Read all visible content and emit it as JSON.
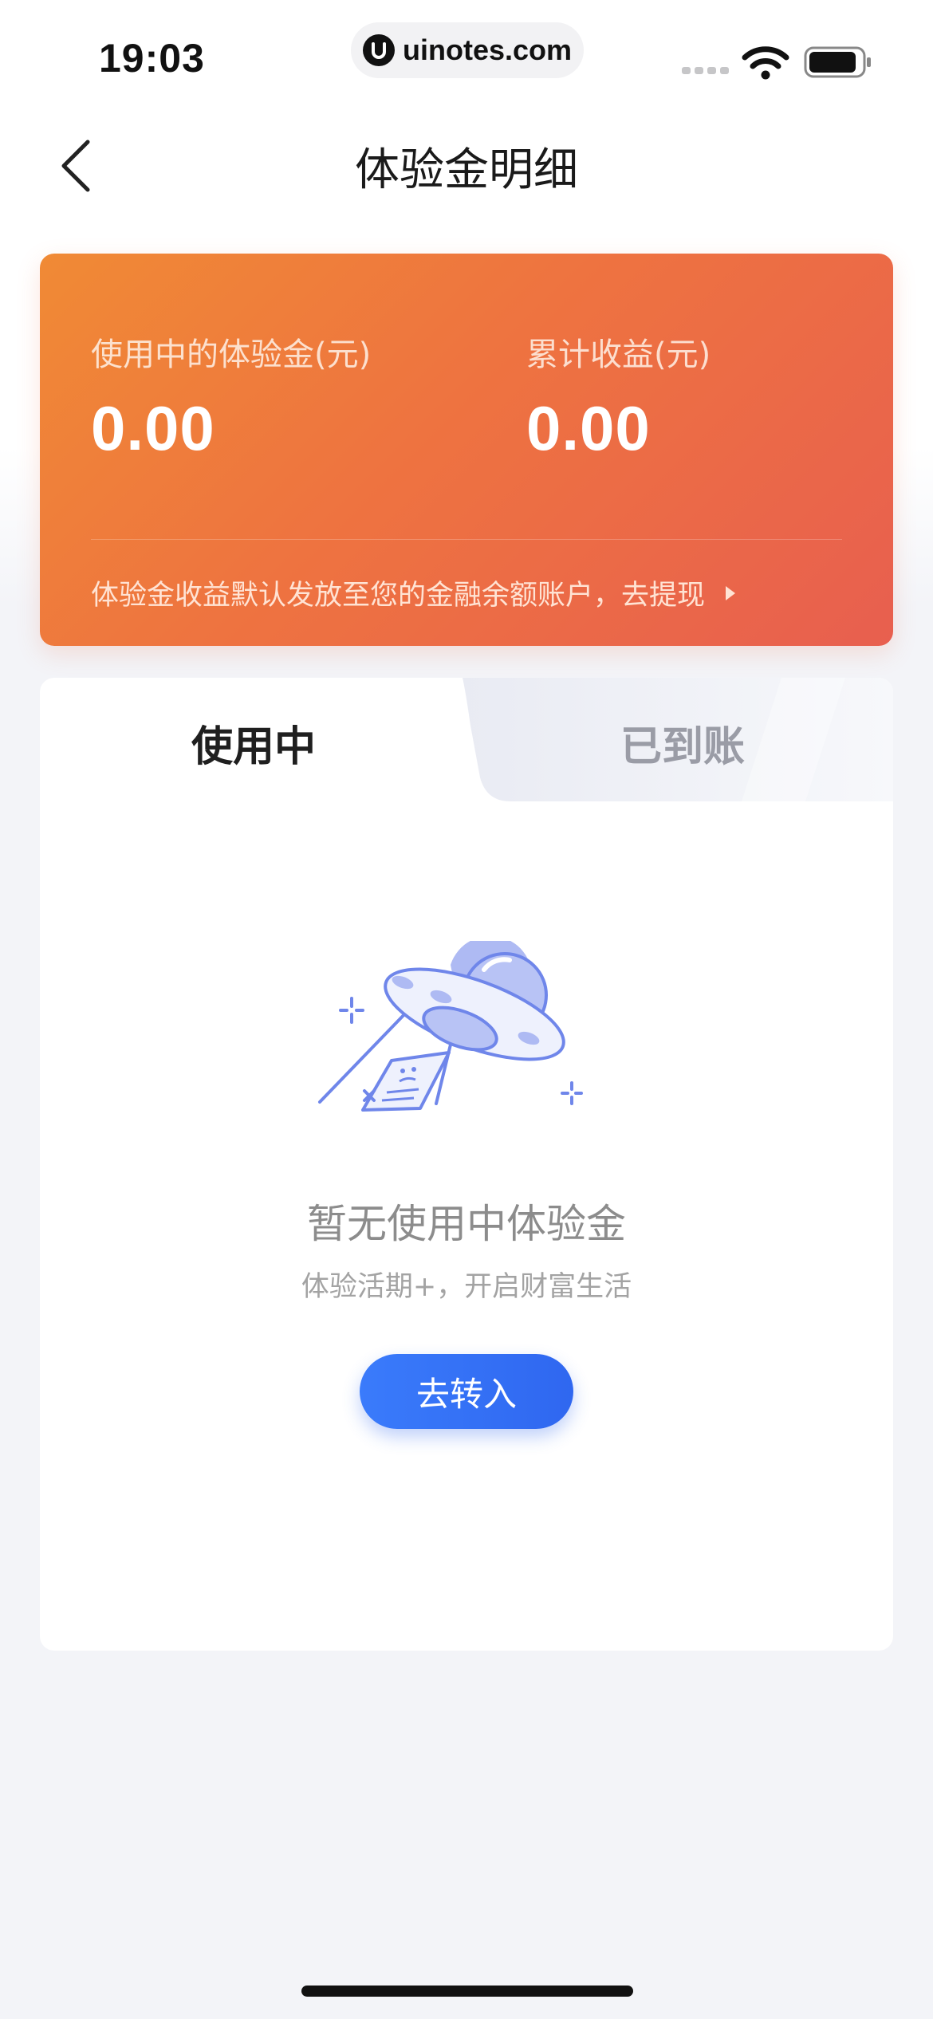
{
  "status_bar": {
    "time": "19:03",
    "url": "uinotes.com"
  },
  "nav": {
    "title": "体验金明细"
  },
  "summary": {
    "in_use_label": "使用中的体验金(元)",
    "in_use_value": "0.00",
    "earnings_label": "累计收益(元)",
    "earnings_value": "0.00",
    "notice": "体验金收益默认发放至您的金融余额账户，去提现"
  },
  "tabs": [
    {
      "label": "使用中",
      "active": true
    },
    {
      "label": "已到账",
      "active": false
    }
  ],
  "empty_state": {
    "title": "暂无使用中体验金",
    "subtitle": "体验活期+，开启财富生活",
    "button_label": "去转入"
  },
  "colors": {
    "accent_blue": "#2f67f0",
    "card_orange": "#f08a35",
    "card_red": "#e85f4f"
  }
}
